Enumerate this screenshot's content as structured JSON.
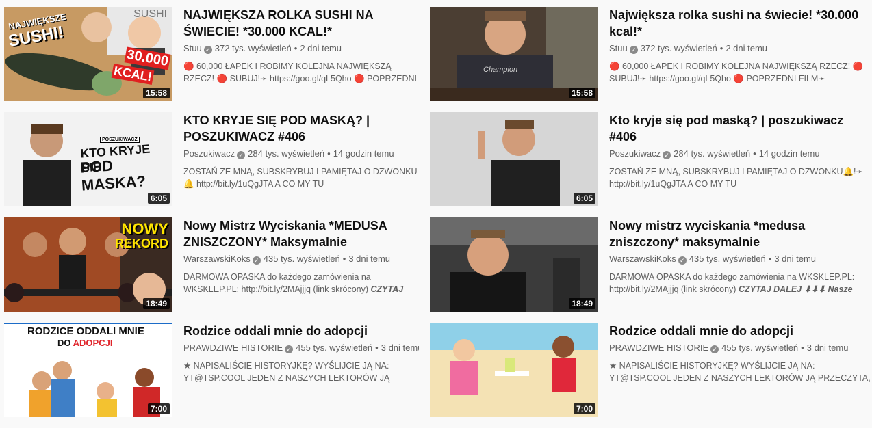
{
  "videos": [
    {
      "title": "NAJWIĘKSZA ROLKA SUSHI NA ŚWIECIE! *30.000 KCAL!*",
      "channel": "Stuu",
      "views": "372 tys. wyświetleń",
      "age": "2 dni temu",
      "desc": "🔴 60,000 ŁAPEK I ROBIMY KOLEJNA NAJWIĘKSZĄ RZECZ! 🔴 SUBUJ!➛ https://goo.gl/qL5Qho 🔴 POPRZEDNI FILM➛",
      "duration": "15:58",
      "thumb_text": [
        "NAJWIĘKSZE",
        "SUSHI!",
        "30.000",
        "KCAL!",
        "SUSHI"
      ]
    },
    {
      "title": "Największa rolka sushi na świecie! *30.000 kcal!*",
      "channel": "Stuu",
      "views": "372 tys. wyświetleń",
      "age": "2 dni temu",
      "desc": "🔴 60,000 ŁAPEK I ROBIMY KOLEJNA NAJWIĘKSZĄ RZECZ! 🔴 SUBUJ!➛ https://goo.gl/qL5Qho 🔴 POPRZEDNI FILM➛",
      "duration": "15:58",
      "thumb_text": [
        "Champion"
      ]
    },
    {
      "title": "KTO KRYJE SIĘ POD MASKĄ? | POSZUKIWACZ #406",
      "channel": "Poszukiwacz",
      "views": "284 tys. wyświetleń",
      "age": "14 godzin temu",
      "desc": "ZOSTAŃ ZE MNĄ, SUBSKRYBUJ I PAMIĘTAJ O DZWONKU🔔 http://bit.ly/1uQgJTA A CO MY TU",
      "duration": "6:05",
      "thumb_text": [
        "POSZUKIWACZ",
        "KTO KRYJE SIE",
        "POD MASKA?"
      ]
    },
    {
      "title": "Kto kryje się pod maską? | poszukiwacz #406",
      "channel": "Poszukiwacz",
      "views": "284 tys. wyświetleń",
      "age": "14 godzin temu",
      "desc": "ZOSTAŃ ZE MNĄ, SUBSKRYBUJ I PAMIĘTAJ O DZWONKU🔔!➛ http://bit.ly/1uQgJTA A CO MY TU",
      "duration": "6:05",
      "thumb_text": []
    },
    {
      "title": "Nowy Mistrz Wyciskania *MEDUSA ZNISZCZONY* Maksymalnie",
      "channel": "WarszawskiKoks",
      "views": "435 tys. wyświetleń",
      "age": "3 dni temu",
      "desc": "DARMOWA OPASKA do każdego zamówienia na WKSKLEP.PL: http://bit.ly/2MAjjjq (link skrócony)",
      "desc_bold": "CZYTAJ DALEJ ⬇⬇⬇",
      "duration": "18:49",
      "thumb_text": [
        "NOWY",
        "REKORD"
      ]
    },
    {
      "title": "Nowy mistrz wyciskania *medusa zniszczony* maksymalnie",
      "channel": "WarszawskiKoks",
      "views": "435 tys. wyświetleń",
      "age": "3 dni temu",
      "desc": "DARMOWA OPASKA do każdego zamówienia na WKSKLEP.PL: http://bit.ly/2MAjjjq (link skrócony)",
      "desc_bold": "CZYTAJ DALEJ ⬇⬇⬇ Nasze",
      "duration": "18:49",
      "thumb_text": []
    },
    {
      "title": "Rodzice oddali mnie do adopcji",
      "channel": "PRAWDZIWE HISTORIE",
      "views": "455 tys. wyświetleń",
      "age": "3 dni temu",
      "desc": "★ NAPISALIŚCIE HISTORYJKĘ? WYŚLIJCIE JĄ NA: YT@TSP.COOL JEDEN Z NASZYCH LEKTORÓW JĄ PRZECZ",
      "duration": "7:00",
      "thumb_text": [
        "RODZICE ODDALI MNIE",
        "DO",
        "ADOPCJI"
      ]
    },
    {
      "title": "Rodzice oddali mnie do adopcji",
      "channel": "PRAWDZIWE HISTORIE",
      "views": "455 tys. wyświetleń",
      "age": "3 dni temu",
      "desc": "★ NAPISALIŚCIE HISTORYJKĘ? WYŚLIJCIE JĄ NA: YT@TSP.COOL JEDEN Z NASZYCH LEKTORÓW JĄ PRZECZYTA, A",
      "duration": "7:00",
      "thumb_text": []
    }
  ],
  "icons": {
    "verified": "check-circle-icon"
  }
}
